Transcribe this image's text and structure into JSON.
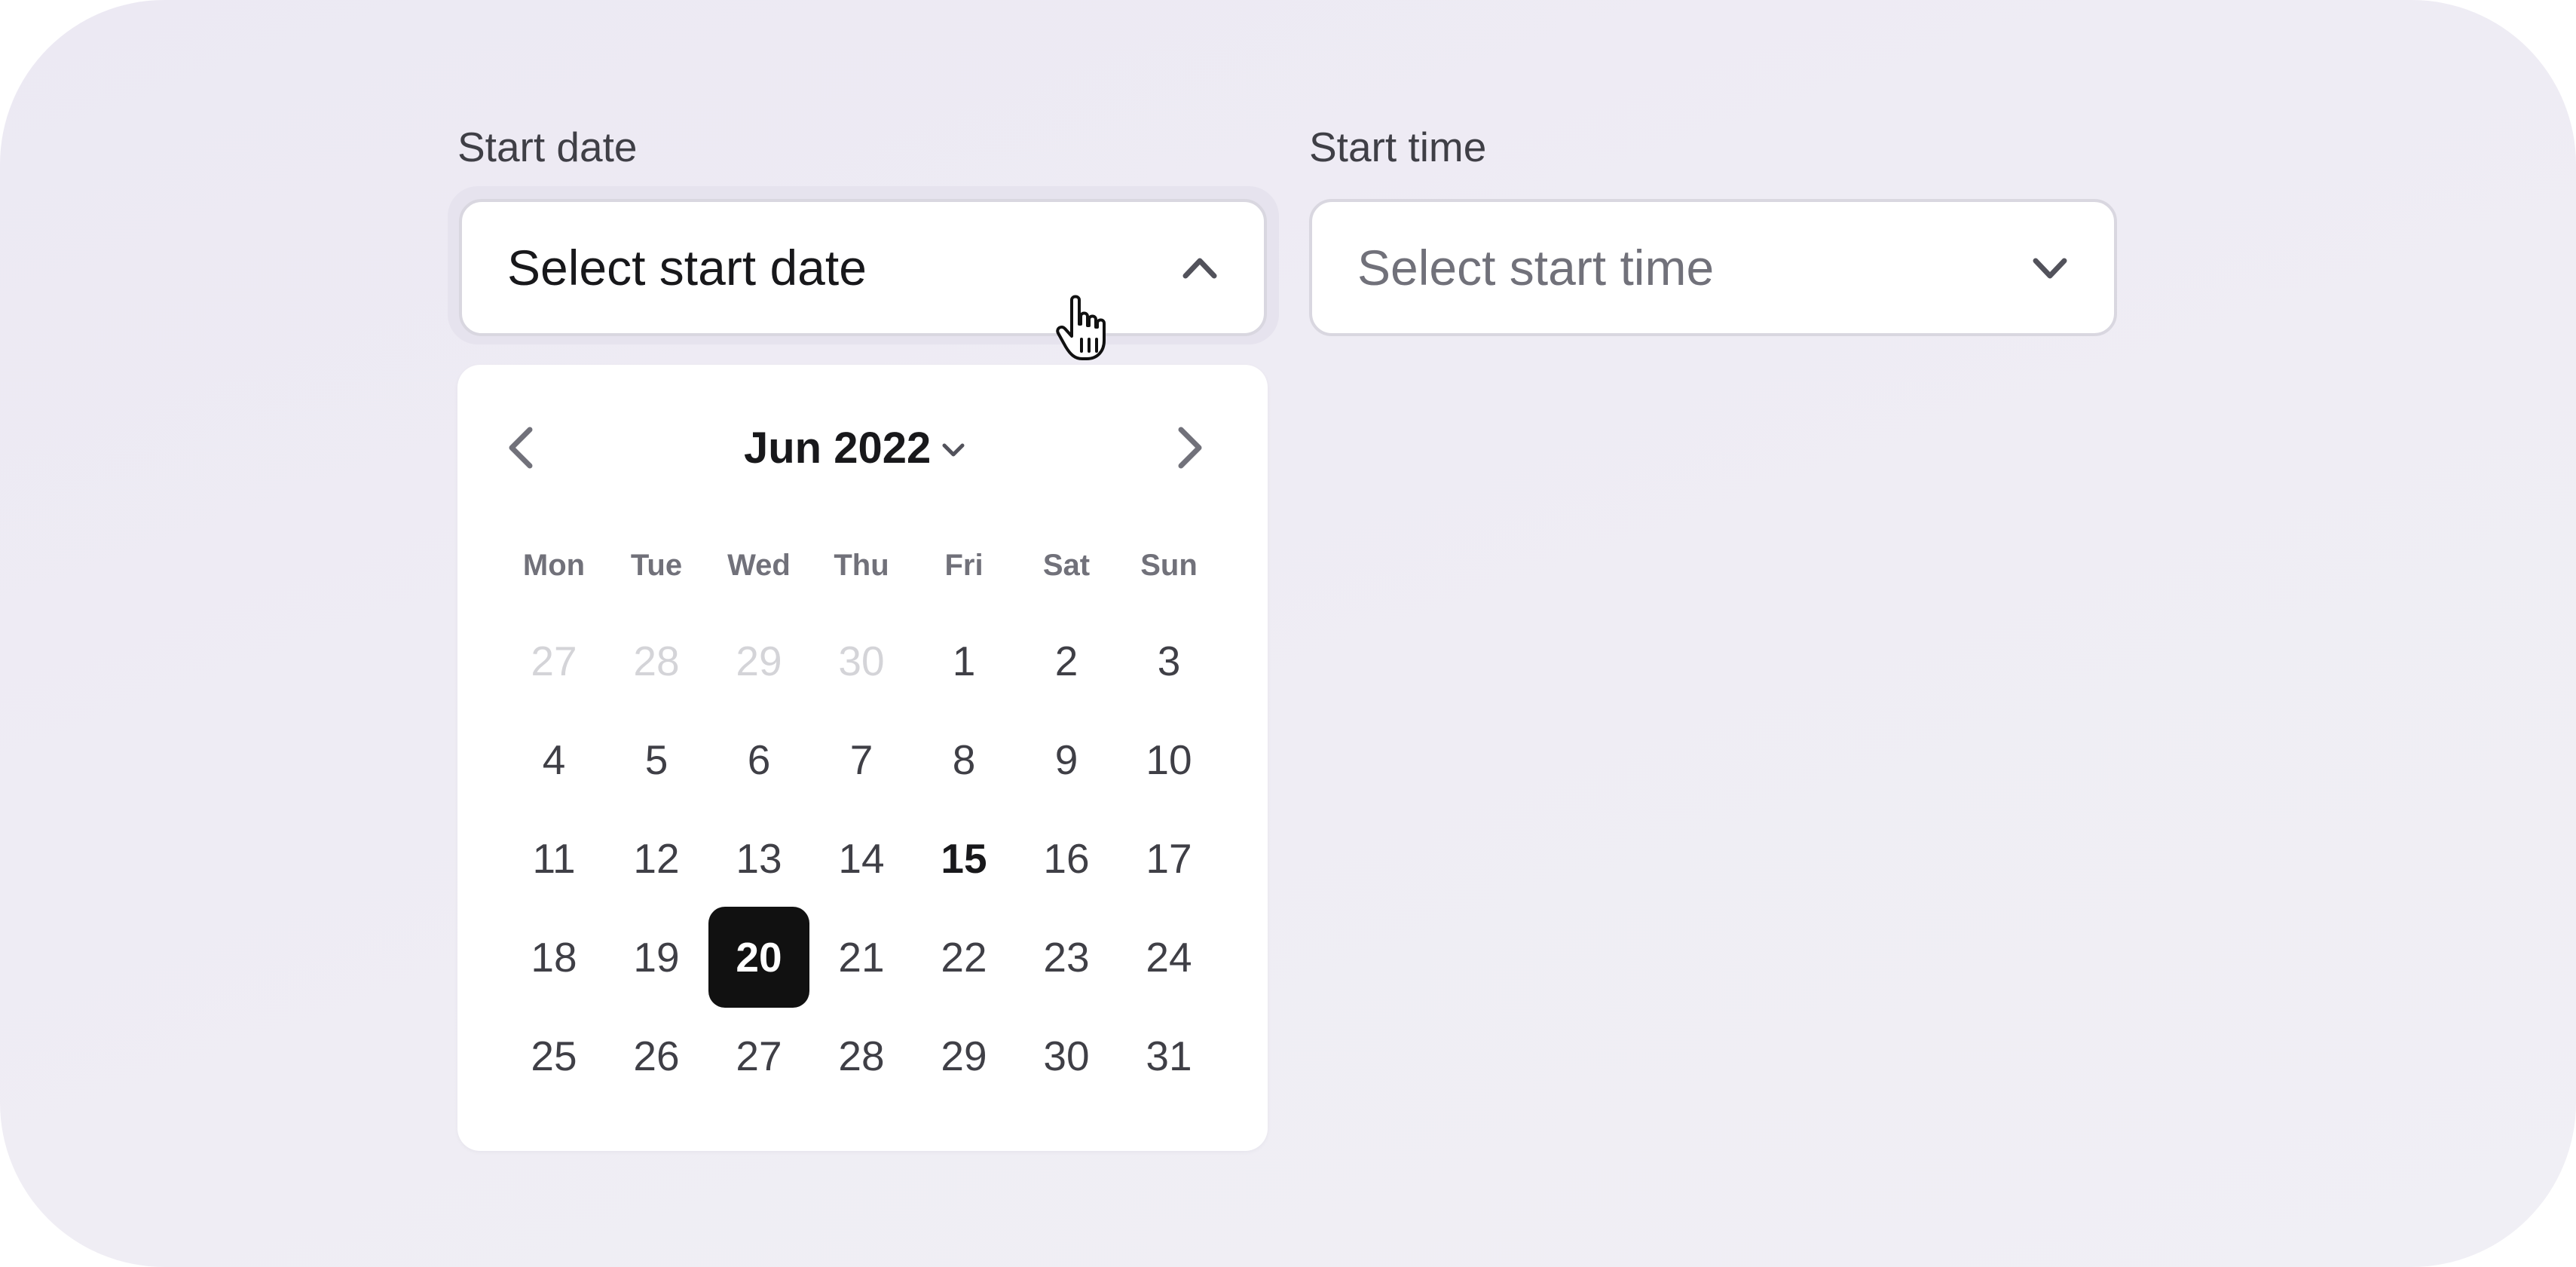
{
  "start_date": {
    "label": "Start date",
    "placeholder": "Select start date",
    "expanded": true,
    "icon": "chevron-up-icon"
  },
  "start_time": {
    "label": "Start time",
    "placeholder": "Select start time",
    "expanded": false,
    "icon": "chevron-down-icon"
  },
  "calendar": {
    "month_label": "Jun 2022",
    "prev_icon": "chevron-left-icon",
    "next_icon": "chevron-right-icon",
    "month_dropdown_icon": "chevron-down-icon",
    "weekdays": [
      "Mon",
      "Tue",
      "Wed",
      "Thu",
      "Fri",
      "Sat",
      "Sun"
    ],
    "weeks": [
      [
        "27",
        "28",
        "29",
        "30",
        "1",
        "2",
        "3"
      ],
      [
        "4",
        "5",
        "6",
        "7",
        "8",
        "9",
        "10"
      ],
      [
        "11",
        "12",
        "13",
        "14",
        "15",
        "16",
        "17"
      ],
      [
        "18",
        "19",
        "20",
        "21",
        "22",
        "23",
        "24"
      ],
      [
        "25",
        "26",
        "27",
        "28",
        "29",
        "30",
        "31"
      ]
    ],
    "outside_month_days": [
      "27",
      "28",
      "29",
      "30"
    ],
    "today": "15",
    "selected": "20"
  },
  "colors": {
    "background": "#eeecf4",
    "selected_bg": "#111111",
    "text": "#3f3f46",
    "muted": "#d4d4d8",
    "placeholder": "#71717a"
  }
}
